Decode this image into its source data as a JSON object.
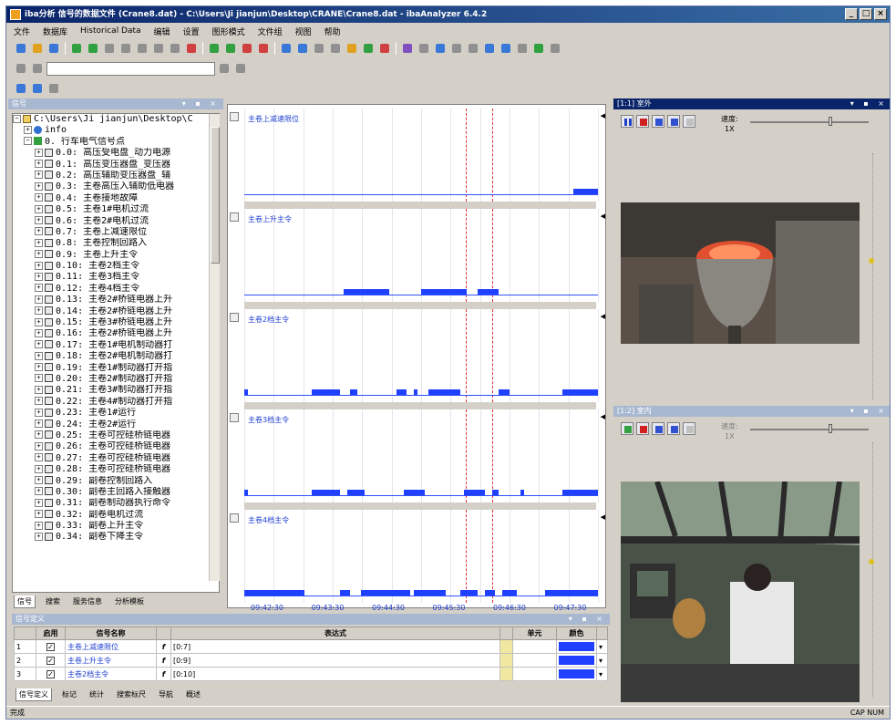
{
  "window": {
    "title": "iba分析 信号的数据文件 (Crane8.dat) - C:\\Users\\Ji jianjun\\Desktop\\CRANE\\Crane8.dat - ibaAnalyzer 6.4.2",
    "controls": [
      "_",
      "□",
      "×"
    ]
  },
  "menu": [
    "文件",
    "数据库",
    "Historical Data",
    "编辑",
    "设置",
    "图形模式",
    "文件组",
    "视图",
    "帮助"
  ],
  "tree": {
    "title": "信号",
    "root": "C:\\Users\\Ji jianjun\\Desktop\\C",
    "info": "info",
    "group": "0. 行车电气信号点",
    "items": [
      "0.0: 高压受电盘_动力电源",
      "0.1: 高压变压器盘_变压器",
      "0.2: 高压辅助变压器盘_辅",
      "0.3: 主卷高压入辅助低电器",
      "0.4: 主卷接地故障",
      "0.5: 主卷1#电机过流",
      "0.6: 主卷2#电机过流",
      "0.7: 主卷上减速限位",
      "0.8: 主卷控制回路入",
      "0.9: 主卷上升主令",
      "0.10: 主卷2档主令",
      "0.11: 主卷3档主令",
      "0.12: 主卷4档主令",
      "0.13: 主卷2#桥链电器上升",
      "0.14: 主卷2#桥链电器上升",
      "0.15: 主卷3#桥链电器上升",
      "0.16: 主卷2#桥链电器上升",
      "0.17: 主卷1#电机制动器打",
      "0.18: 主卷2#电机制动器打",
      "0.19: 主卷1#制动器打开指",
      "0.20: 主卷2#制动器打开指",
      "0.21: 主卷3#制动器打开指",
      "0.22: 主卷4#制动器打开指",
      "0.23: 主卷1#运行",
      "0.24: 主卷2#运行",
      "0.25: 主卷可控硅桥链电器",
      "0.26: 主卷可控硅桥链电器",
      "0.27: 主卷可控硅桥链电器",
      "0.28: 主卷可控硅桥链电器",
      "0.29: 副卷控制回路入",
      "0.30: 副卷主回路入接触器",
      "0.31: 副卷制动器执行命令",
      "0.32: 副卷电机过流",
      "0.33: 副卷上升主令",
      "0.34: 副卷下降主令"
    ],
    "tabs": [
      "信号",
      "搜索",
      "服务信息",
      "分析模板"
    ]
  },
  "charts": [
    {
      "title": "主卷上减速限位"
    },
    {
      "title": "主卷上升主令"
    },
    {
      "title": "主卷2档主令"
    },
    {
      "title": "主卷3档主令"
    },
    {
      "title": "主卷4档主令"
    }
  ],
  "chart_data": {
    "type": "line",
    "x_ticks": [
      "09:42:30",
      "09:43:30",
      "09:44:30",
      "09:45:30",
      "09:46:30",
      "09:47:30"
    ],
    "markers": [
      "09:45:30",
      "09:46:06"
    ],
    "series": [
      {
        "name": "主卷上减速限位",
        "segments": [
          [
            0.93,
            1.0
          ]
        ]
      },
      {
        "name": "主卷上升主令",
        "segments": [
          [
            0.28,
            0.41
          ],
          [
            0.5,
            0.63
          ],
          [
            0.66,
            0.72
          ]
        ]
      },
      {
        "name": "主卷2档主令",
        "segments": [
          [
            0.0,
            0.01
          ],
          [
            0.19,
            0.27
          ],
          [
            0.3,
            0.32
          ],
          [
            0.43,
            0.46
          ],
          [
            0.48,
            0.49
          ],
          [
            0.52,
            0.61
          ],
          [
            0.72,
            0.73
          ],
          [
            0.73,
            0.75
          ],
          [
            0.9,
            1.0
          ]
        ]
      },
      {
        "name": "主卷3档主令",
        "segments": [
          [
            0.0,
            0.01
          ],
          [
            0.19,
            0.27
          ],
          [
            0.29,
            0.34
          ],
          [
            0.45,
            0.51
          ],
          [
            0.62,
            0.68
          ],
          [
            0.7,
            0.72
          ],
          [
            0.78,
            0.79
          ],
          [
            0.9,
            1.0
          ]
        ]
      },
      {
        "name": "主卷4档主令",
        "segments": [
          [
            0.0,
            0.17
          ],
          [
            0.27,
            0.3
          ],
          [
            0.33,
            0.47
          ],
          [
            0.48,
            0.57
          ],
          [
            0.61,
            0.66
          ],
          [
            0.68,
            0.71
          ],
          [
            0.73,
            0.77
          ],
          [
            0.85,
            1.0
          ]
        ]
      }
    ]
  },
  "video": [
    {
      "title": "[1:1] 室外",
      "speed_label": "速度:",
      "speed_value": "1X"
    },
    {
      "title": "[1:2] 室内",
      "speed_label": "速度:",
      "speed_value": "1X"
    }
  ],
  "signal_table": {
    "title": "信号定义",
    "headers": [
      "",
      "启用",
      "信号名称",
      "",
      "表达式",
      "",
      "单元",
      "颜色",
      ""
    ],
    "rows": [
      {
        "no": "1",
        "name": "主卷上减速限位",
        "expr": "[0:7]"
      },
      {
        "no": "2",
        "name": "主卷上升主令",
        "expr": "[0:9]"
      },
      {
        "no": "3",
        "name": "主卷2档主令",
        "expr": "[0:10]"
      }
    ],
    "tabs": [
      "信号定义",
      "标记",
      "统计",
      "搜索标尺",
      "导航",
      "概述"
    ]
  },
  "status": {
    "left": "完成",
    "right": "CAP NUM"
  },
  "colors": {
    "signal": "#2040ff",
    "marker": "#e03030",
    "title": "#0a246a"
  }
}
